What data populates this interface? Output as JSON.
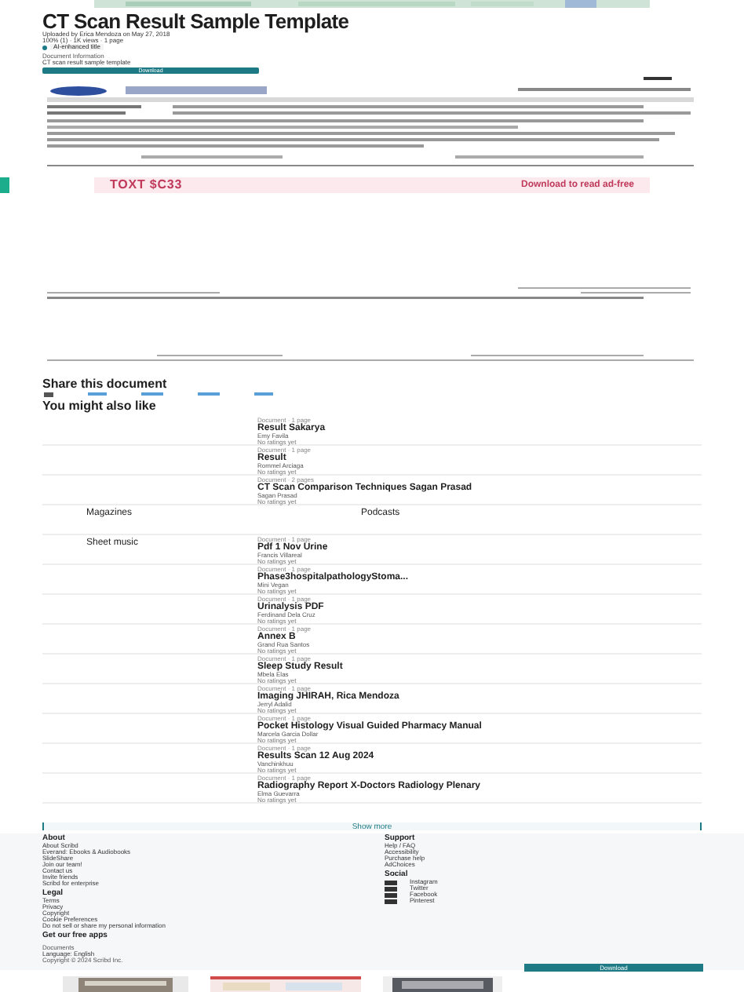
{
  "title": "CT Scan Result Sample Template",
  "uploader": "Uploaded by Erica Mendoza on May 27, 2018",
  "stats": "100% (1) · 1K views · 1 page",
  "ai_badge": "AI-enhanced title",
  "doc_info": {
    "heading": "Document Information",
    "description": "CT scan result sample template"
  },
  "download_button": "Download",
  "bottom_download_button": "Download",
  "ad": {
    "left": "TOXT $C33",
    "right": "Download to read ad-free"
  },
  "share": {
    "heading": "Share this document"
  },
  "related": {
    "heading": "You might also like",
    "items": [
      {
        "kind": "doc",
        "meta": "Document · 1 page",
        "title": "Result Sakarya",
        "author": "Emy Favila",
        "rating": "No ratings yet"
      },
      {
        "kind": "doc",
        "meta": "Document · 1 page",
        "title": "Result",
        "author": "Rommel Arciaga",
        "rating": "No ratings yet"
      },
      {
        "kind": "doc",
        "meta": "Document · 2 pages",
        "title": "CT Scan Comparison Techniques Sagan Prasad",
        "author": "Sagan Prasad",
        "rating": "No ratings yet"
      },
      {
        "kind": "nav",
        "left": "Magazines",
        "right": "Podcasts",
        "below": "Sheet music"
      },
      {
        "kind": "doc",
        "meta": "Document · 1 page",
        "title": "Pdf 1 Nov Urine",
        "author": "Francis Villareal",
        "rating": "No ratings yet"
      },
      {
        "kind": "doc",
        "meta": "Document · 1 page",
        "title": "Phase3hospitalpathologyStoma...",
        "author": "Mini Vegan",
        "rating": "No ratings yet"
      },
      {
        "kind": "doc",
        "meta": "Document · 1 page",
        "title": "Urinalysis PDF",
        "author": "Ferdinand Dela Cruz",
        "rating": "No ratings yet"
      },
      {
        "kind": "doc",
        "meta": "Document · 1 page",
        "title": "Annex B",
        "author": "Grand Rua Santos",
        "rating": "No ratings yet"
      },
      {
        "kind": "doc",
        "meta": "Document · 1 page",
        "title": "Sleep Study Result",
        "author": "Mbela Elas",
        "rating": "No ratings yet"
      },
      {
        "kind": "doc",
        "meta": "Document · 1 page",
        "title": "Imaging JHIRAH, Rica Mendoza",
        "author": "Jerryl Adalid",
        "rating": "No ratings yet"
      },
      {
        "kind": "doc",
        "meta": "Document · 1 page",
        "title": "Pocket Histology Visual Guided Pharmacy Manual",
        "author": "Marcela Garcia Dollar",
        "rating": "No ratings yet"
      },
      {
        "kind": "doc",
        "meta": "Document · 1 page",
        "title": "Results Scan 12 Aug 2024",
        "author": "Vanchinkhuu",
        "rating": "No ratings yet"
      },
      {
        "kind": "doc",
        "meta": "Document · 1 page",
        "title": "Radiography Report X-Doctors Radiology Plenary",
        "author": "Elma Guevarra",
        "rating": "No ratings yet"
      }
    ]
  },
  "show_more": "Show more",
  "footer": {
    "columns": [
      {
        "heading": "About",
        "links": [
          "About Scribd",
          "Everand: Ebooks & Audiobooks",
          "SlideShare",
          "Join our team!",
          "Contact us",
          "Invite friends",
          "Scribd for enterprise"
        ]
      },
      {
        "heading": "Support",
        "links": [
          "Help / FAQ",
          "Accessibility",
          "Purchase help",
          "AdChoices"
        ]
      }
    ],
    "legal": {
      "heading": "Legal",
      "links": [
        "Terms",
        "Privacy",
        "Copyright",
        "Cookie Preferences",
        "Do not sell or share my personal information"
      ]
    },
    "social": {
      "heading": "Social",
      "links": [
        "Instagram",
        "Twitter",
        "Facebook",
        "Pinterest"
      ]
    },
    "apps": "Get our free apps",
    "documents": "Documents",
    "language": "Language: English",
    "copyright": "Copyright © 2024 Scribd Inc."
  }
}
